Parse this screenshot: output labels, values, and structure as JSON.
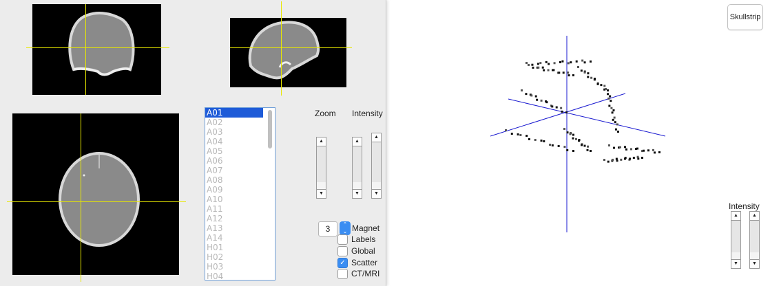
{
  "list": {
    "items": [
      "A01",
      "A02",
      "A03",
      "A04",
      "A05",
      "A06",
      "A07",
      "A08",
      "A09",
      "A10",
      "A11",
      "A12",
      "A13",
      "A14",
      "H01",
      "H02",
      "H03",
      "H04"
    ],
    "selected_index": 0
  },
  "controls": {
    "zoom_label": "Zoom",
    "intensity_label": "Intensity",
    "magnet_value": "3",
    "magnet_label": "Magnet",
    "checkboxes": [
      {
        "label": "Labels",
        "checked": false
      },
      {
        "label": "Global",
        "checked": false
      },
      {
        "label": "Scatter",
        "checked": true
      },
      {
        "label": "CT/MRI",
        "checked": false
      }
    ]
  },
  "right": {
    "skullstrip_label": "Skullstrip",
    "intensity_label": "Intensity"
  },
  "colors": {
    "crosshair": "#e8e800",
    "axis": "#1a1ad0",
    "selection": "#1e5bd8",
    "accent": "#3a8df2"
  }
}
